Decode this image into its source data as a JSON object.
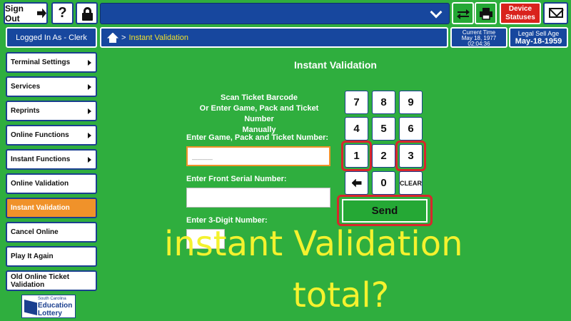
{
  "topbar": {
    "sign_out_label": "Sign Out",
    "help_label": "?",
    "device_statuses_line1": "Device",
    "device_statuses_line2": "Statuses"
  },
  "subbar": {
    "logged_in": "Logged In As - Clerk",
    "breadcrumb_separator": ">",
    "breadcrumb_page": "Instant Validation",
    "current_time_label": "Current Time",
    "current_date": "May 18, 1977",
    "current_time": "02:04:36",
    "legal_age_label": "Legal Sell Age",
    "legal_age_date": "May-18-1959"
  },
  "sidebar": {
    "items": [
      {
        "label": "Terminal Settings"
      },
      {
        "label": "Services"
      },
      {
        "label": "Reprints"
      },
      {
        "label": "Online Functions"
      },
      {
        "label": "Instant Functions"
      },
      {
        "label": "Online Validation"
      },
      {
        "label": "Instant Validation"
      },
      {
        "label": "Cancel Online"
      },
      {
        "label": "Play It Again"
      },
      {
        "label": "Old Online Ticket Validation"
      }
    ]
  },
  "logo": {
    "line1": "South Carolina",
    "line2": "Education",
    "line3": "Lottery"
  },
  "main": {
    "title": "Instant Validation",
    "instructions_line1": "Scan Ticket Barcode",
    "instructions_line2": "Or Enter Game, Pack and Ticket Number",
    "instructions_line3": "Manually",
    "game_label": "Enter Game, Pack and Ticket Number:",
    "game_placeholder": "____",
    "serial_label": "Enter Front Serial Number:",
    "digit_label": "Enter 3-Digit Number:"
  },
  "keypad": {
    "keys": [
      "7",
      "8",
      "9",
      "4",
      "5",
      "6",
      "1",
      "2",
      "3",
      "0"
    ],
    "clear_label": "CLEAR",
    "send_label": "Send"
  },
  "overlay": {
    "line1": "instant Validation",
    "line2": "total?"
  },
  "colors": {
    "background": "#2fae3e",
    "nav_blue": "#17479e",
    "active_orange": "#f0922a",
    "alert_red": "#d9231d",
    "highlight_red": "#d8262c",
    "overlay_yellow": "#f4f22e"
  }
}
